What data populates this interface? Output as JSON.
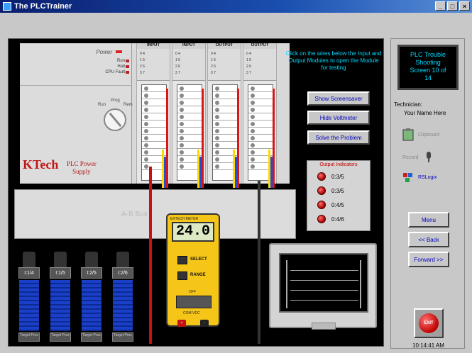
{
  "window": {
    "title": "The PLCTrainer",
    "min_label": "_",
    "max_label": "□",
    "close_label": "×"
  },
  "instructions": "Click on the wires below the Input and Output Modules to open the Module for testing",
  "power_supply": {
    "power_label": "Power",
    "status": [
      "Run",
      "Halt",
      "CPU Fault"
    ],
    "knob_labels": [
      "Run",
      "Prog",
      "Rem"
    ],
    "logo_text": "KTech",
    "name_line1": "PLC Power",
    "name_line2": "Supply"
  },
  "modules": [
    {
      "label": "INPUT",
      "rows": [
        "0  4",
        "1  5",
        "2  6",
        "3  7"
      ]
    },
    {
      "label": "INPUT",
      "rows": [
        "0  4",
        "1  5",
        "2  6",
        "3  7"
      ]
    },
    {
      "label": "OUTPUT",
      "rows": [
        "0  4",
        "1  5",
        "2  6",
        "3  7"
      ]
    },
    {
      "label": "OUTPUT",
      "rows": [
        "0  4",
        "1  5",
        "2  6",
        "3  7"
      ]
    }
  ],
  "bus_label": "A-B Bus",
  "buttons": {
    "screensaver": "Show Screensaver",
    "voltmeter": "Hide Voltmeter",
    "solve": "Solve the Problem"
  },
  "output_indicators": {
    "title": "Output Indicators",
    "items": [
      "0:3/5",
      "0:3/5",
      "0:4/5",
      "0:4/6"
    ]
  },
  "sensors": [
    {
      "label": "I:1/4",
      "base": "Target Prox"
    },
    {
      "label": "I:1/5",
      "base": "Target Prox"
    },
    {
      "label": "I:2/5",
      "base": "Target Prox"
    },
    {
      "label": "I:2/6",
      "base": "Target Prox"
    }
  ],
  "meter": {
    "brand": "EXTECH METER",
    "reading": "24.0",
    "unit": "V",
    "select": "SELECT",
    "range": "RANGE",
    "off": "OFF",
    "dial_labels": "COM VDC"
  },
  "side": {
    "title_line1": "PLC Trouble",
    "title_line2": "Shooting",
    "title_line3": "Screen 10 of",
    "title_line4": "14",
    "tech_label": "Technician:",
    "tech_name": "Your Name Here",
    "tool_clipboard": "Clipboard",
    "tool_record": "Record",
    "tool_rslogix": "RSLogix",
    "menu": "Menu",
    "back": "<< Back",
    "forward": "Forward >>",
    "exit": "EXIT",
    "clock": "10:14:41 AM"
  }
}
